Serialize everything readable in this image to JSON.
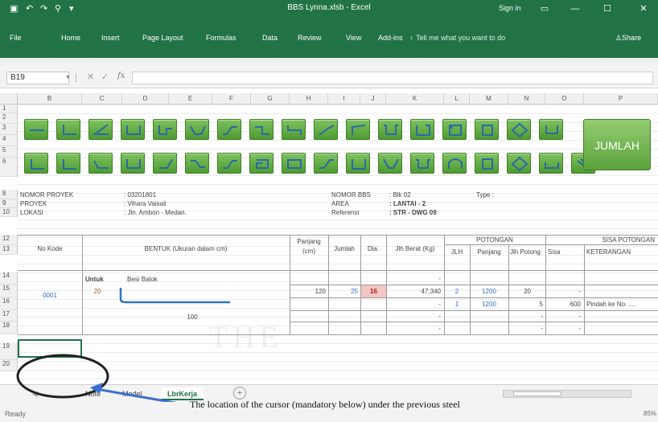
{
  "window": {
    "title": "BBS Lynna.xlsb - Excel",
    "sign_in": "Sign in",
    "tabs": [
      "File",
      "Home",
      "Insert",
      "Page Layout",
      "Formulas",
      "Data",
      "Review",
      "View",
      "Add-ins"
    ],
    "tell_me": "Tell me what you want to do",
    "share": "Share"
  },
  "formula_bar": {
    "name_box": "B19",
    "fx": "fx",
    "value": ""
  },
  "columns": [
    "B",
    "C",
    "D",
    "E",
    "F",
    "G",
    "H",
    "I",
    "J",
    "K",
    "L",
    "M",
    "N",
    "O",
    "P"
  ],
  "rows": [
    "1",
    "2",
    "3",
    "4",
    "5",
    "6",
    "8",
    "9",
    "10",
    "12",
    "13",
    "14",
    "15",
    "16",
    "17",
    "18",
    "19",
    "20"
  ],
  "jumlah_button": "JUMLAH",
  "info": {
    "nomor_proyek_label": "NOMOR PROYEK",
    "nomor_proyek_value": ": 03201801",
    "proyek_label": "PROYEK",
    "proyek_value": ": Vihara Vaisali",
    "lokasi_label": "LOKASI",
    "lokasi_value": ": Jln. Ambon - Medan.",
    "nomor_bbs_label": "NOMOR BBS",
    "nomor_bbs_value": ": Blk 02",
    "area_label": "AREA",
    "area_value": ": LANTAI - 2",
    "referensi_label": "Referensi",
    "referensi_value": ": STR - DWG 09",
    "type_label": "Type :"
  },
  "table": {
    "headers": {
      "no_kode": "No Kode",
      "bentuk": "BENTUK (Ukuran dalam cm)",
      "panjang": "Panjang",
      "panjang_unit": "(cm)",
      "jumlah": "Jumlah",
      "dia": "Dia.",
      "berat": "Jlh Berat (Kg)",
      "potongan": "POTONGAN",
      "jlh": "JLH",
      "pot_panjang": "Panjang",
      "jlh_potong": "Jlh Potong",
      "sisa_potongan": "SISA POTONGAN",
      "sisa": "Sisa",
      "keterangan": "KETERANGAN"
    },
    "untuk_label": "Untuk",
    "untuk_value": "Besi Balok",
    "kode": "0001",
    "dim_top": "20",
    "dim_bottom": "100",
    "row14_berat": "-",
    "row15": {
      "panjang": "120",
      "jumlah": "25",
      "dia": "16",
      "berat": "47,340",
      "jlh": "2",
      "pot_panjang": "1200",
      "jlh_potong": "20",
      "sisa": "-"
    },
    "row16": {
      "berat": "-",
      "jlh": "1",
      "pot_panjang": "1200",
      "jlh_potong": "5",
      "sisa": "600",
      "keterangan": "Pindah ke No. ...."
    },
    "row17": {
      "berat": "-",
      "jlh_potong": "-",
      "sisa": "-"
    },
    "row18": {
      "berat": "-",
      "jlh_potong": "-",
      "sisa": "-"
    }
  },
  "sheets": [
    "Note",
    "Model",
    "LbrKerja"
  ],
  "active_sheet": "LbrKerja",
  "status": {
    "ready": "Ready",
    "zoom": "85%"
  },
  "caption": "The location of the cursor (mandatory below) under the previous steel",
  "watermark": "THE",
  "colors": {
    "excel_green": "#217346",
    "shape_green": "#5ba23c",
    "annotation": "#3b6fd0"
  }
}
